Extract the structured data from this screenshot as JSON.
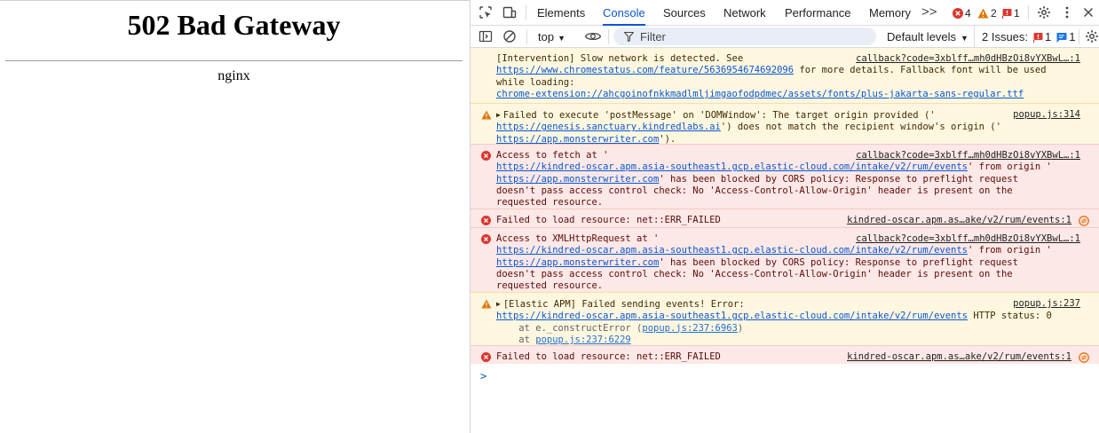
{
  "page": {
    "title": "502 Bad Gateway",
    "server": "nginx"
  },
  "devtools": {
    "tabs": [
      "Elements",
      "Console",
      "Sources",
      "Network",
      "Performance",
      "Memory"
    ],
    "active_tab": "Console",
    "more_tabs": ">>",
    "counts": {
      "errors": "4",
      "warnings": "2",
      "issues": "1"
    },
    "toolbar": {
      "context": "top",
      "filter_placeholder": "Filter",
      "levels": "Default levels",
      "issues_label": "2 Issues:",
      "issues_errors": "1",
      "issues_info": "1"
    },
    "colors": {
      "accent": "#0b57d0",
      "warning_bg": "#fef7e0",
      "error_bg": "#fce8e6",
      "error_icon": "#dc362e",
      "warning_icon": "#e37400"
    }
  },
  "messages": [
    {
      "level": "warning",
      "source": "callback?code=3xblff…mh0dHBzOi8vYXBwL…:1",
      "line1": "[Intervention] Slow network is detected. See",
      "link1": "https://www.chromestatus.com/feature/5636954674692096",
      "text2": " for more details. Fallback font will be used",
      "line3": "while loading:",
      "link2": "chrome-extension://ahcgoinofnkkmadlmljimgaofodpdmec/assets/fonts/plus-jakarta-sans-regular.ttf"
    },
    {
      "level": "warning",
      "source": "popup.js:314",
      "line1": "Failed to execute 'postMessage' on 'DOMWindow': The target origin provided ('",
      "link1": "https://genesis.sanctuary.kindredlabs.ai",
      "text2": "') does not match the recipient window's origin ('",
      "link2": "https://app.monsterwriter.com",
      "text3": "')."
    },
    {
      "level": "error",
      "source": "callback?code=3xblff…mh0dHBzOi8vYXBwL…:1",
      "line1": "Access to fetch at '",
      "link1": "https://kindred-oscar.apm.asia-southeast1.gcp.elastic-cloud.com/intake/v2/rum/events",
      "text2": "' from origin '",
      "link2": "https://app.monsterwriter.com",
      "text3": "' has been blocked by CORS policy: Response to preflight request",
      "line4": "doesn't pass access control check: No 'Access-Control-Allow-Origin' header is present on the",
      "line5": "requested resource."
    },
    {
      "level": "error",
      "source": "kindred-oscar.apm.as…ake/v2/rum/events:1",
      "line1": "Failed to load resource: net::ERR_FAILED"
    },
    {
      "level": "error",
      "source": "callback?code=3xblff…mh0dHBzOi8vYXBwL…:1",
      "line1": "Access to XMLHttpRequest at '",
      "link1": "https://kindred-oscar.apm.asia-southeast1.gcp.elastic-cloud.com/intake/v2/rum/events",
      "text2": "' from origin '",
      "link2": "https://app.monsterwriter.com",
      "text3": "' has been blocked by CORS policy: Response to preflight request",
      "line4": "doesn't pass access control check: No 'Access-Control-Allow-Origin' header is present on the",
      "line5": "requested resource."
    },
    {
      "level": "warning",
      "source": "popup.js:237",
      "line1": "[Elastic APM] Failed sending events! Error:",
      "link1": "https://kindred-oscar.apm.asia-southeast1.gcp.elastic-cloud.com/intake/v2/rum/events",
      "text2": " HTTP status: 0",
      "stack1_pre": "    at e._constructError (",
      "stack1_link": "popup.js:237:6963",
      "stack1_post": ")",
      "stack2_pre": "    at ",
      "stack2_link": "popup.js:237:6229"
    },
    {
      "level": "error",
      "source": "kindred-oscar.apm.as…ake/v2/rum/events:1",
      "line1": "Failed to load resource: net::ERR_FAILED"
    }
  ],
  "prompt_symbol": ">"
}
